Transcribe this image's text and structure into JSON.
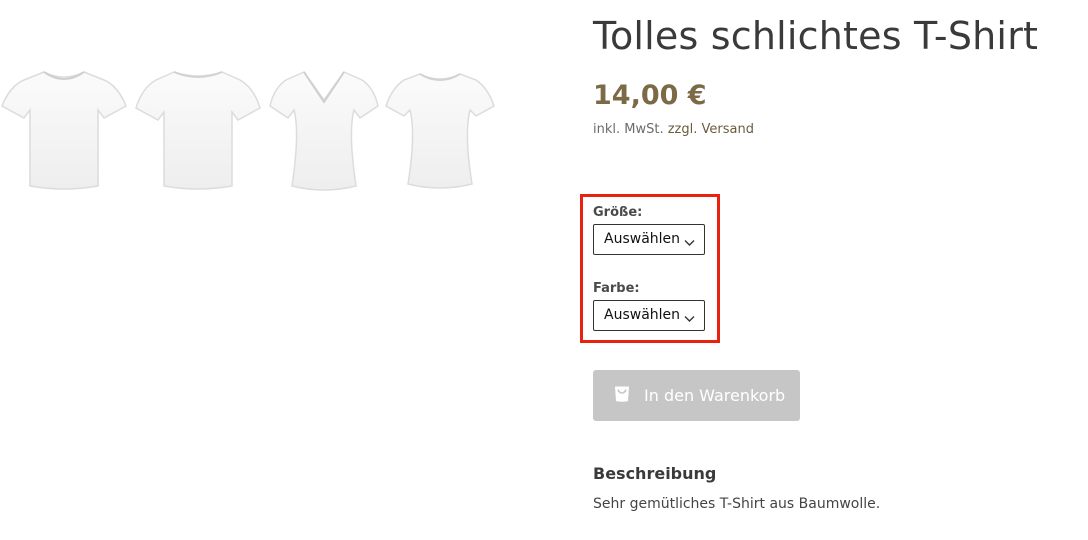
{
  "product": {
    "title": "Tolles schlichtes T-Shirt",
    "price": "14,00 €",
    "tax_note": "inkl. MwSt.",
    "shipping_link": "zzgl. Versand"
  },
  "gallery": {
    "images": [
      {
        "icon": "tshirt-crew-neck-icon"
      },
      {
        "icon": "tshirt-wide-neck-icon"
      },
      {
        "icon": "tshirt-v-neck-icon"
      },
      {
        "icon": "tshirt-fitted-icon"
      }
    ]
  },
  "variations": {
    "size": {
      "label": "Größe:",
      "value": "Auswählen"
    },
    "color": {
      "label": "Farbe:",
      "value": "Auswählen"
    },
    "highlight_color": "#e8220f"
  },
  "cart": {
    "label": "In den Warenkorb",
    "icon": "shopping-bag-icon",
    "state": "disabled"
  },
  "description": {
    "heading": "Beschreibung",
    "text": "Sehr gemütliches T-Shirt aus Baumwolle."
  },
  "colors": {
    "price": "#7c6a47",
    "title": "#3a3a3a",
    "button_disabled": "#c6c6c6"
  }
}
